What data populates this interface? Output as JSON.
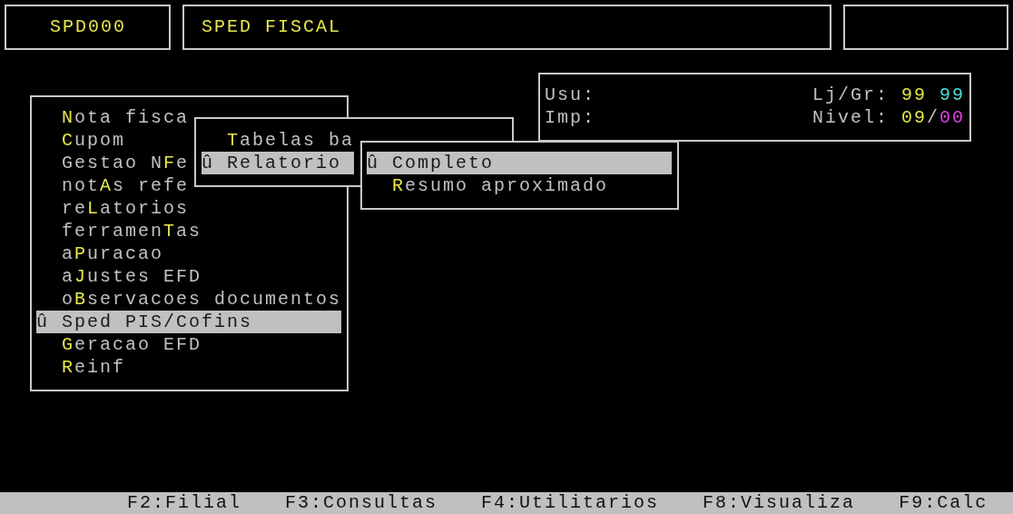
{
  "header": {
    "program_code": "SPD000",
    "title": "SPED FISCAL"
  },
  "info_panel": {
    "rows": [
      {
        "label": "Usu:",
        "right_label": "Lj/Gr:",
        "spaced": true,
        "values": [
          {
            "text": "99",
            "color": "#e6e64a"
          },
          {
            "text": "99",
            "color": "#4fe0e0"
          }
        ]
      },
      {
        "label": "Imp:",
        "right_label": "Nivel:",
        "spaced": false,
        "values": [
          {
            "text": "09",
            "color": "#e6e64a"
          },
          {
            "text": "/",
            "color": "#c0c0c0"
          },
          {
            "text": "00",
            "color": "#e040e8"
          }
        ]
      }
    ]
  },
  "main_menu": {
    "items": [
      {
        "label": "**N**ota fisca",
        "selected": false
      },
      {
        "label": "**C**upom",
        "selected": false
      },
      {
        "label": "Gestao N**F**e",
        "selected": false
      },
      {
        "label": "not**A**s refe",
        "selected": false
      },
      {
        "label": "re**L**atorios",
        "selected": false
      },
      {
        "label": "ferramen**T**as",
        "selected": false
      },
      {
        "label": "a**P**uracao",
        "selected": false
      },
      {
        "label": "a**J**ustes EFD",
        "selected": false
      },
      {
        "label": "o**B**servacoes documentos",
        "selected": false
      },
      {
        "label": "Sped PIS/Cofins",
        "selected": true,
        "marker": "û"
      },
      {
        "label": "**G**eracao EFD",
        "selected": false
      },
      {
        "label": "**R**einf",
        "selected": false
      }
    ]
  },
  "submenu": {
    "items": [
      {
        "label": "**T**abelas ba",
        "selected": false
      },
      {
        "label": "Relatorio",
        "selected": true,
        "marker": "û"
      }
    ]
  },
  "report_menu": {
    "items": [
      {
        "label": "Completo",
        "selected": true,
        "marker": "û"
      },
      {
        "label": "**R**esumo aproximado",
        "selected": false
      }
    ]
  },
  "status_bar": {
    "keys": [
      "F2:Filial",
      "F3:Consultas",
      "F4:Utilitarios",
      "F8:Visualiza",
      "F9:Calc"
    ]
  }
}
